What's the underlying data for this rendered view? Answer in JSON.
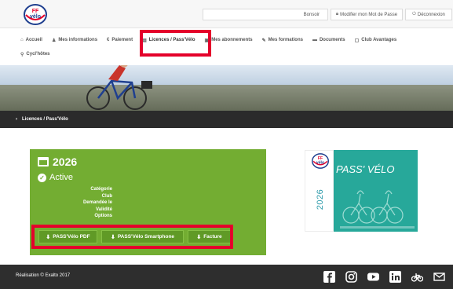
{
  "header": {
    "greeting": "Bonsoir",
    "change_password": "Modifier mon Mot de Passe",
    "logout": "Déconnexion",
    "logo_text_top": "FF",
    "logo_text_bottom": "vélo"
  },
  "nav": {
    "row1": [
      {
        "icon": "home-icon",
        "label": "Accueil",
        "glyph": "⌂"
      },
      {
        "icon": "users-icon",
        "label": "Mes informations",
        "glyph": "♟"
      },
      {
        "icon": "euro-icon",
        "label": "Paiement",
        "glyph": "€"
      },
      {
        "icon": "id-card-icon",
        "label": "Licences / Pass'Vélo",
        "glyph": "▤",
        "active": true
      },
      {
        "icon": "card-icon",
        "label": "Mes abonnements",
        "glyph": "▣"
      },
      {
        "icon": "graduation-cap-icon",
        "label": "Mes formations",
        "glyph": "✎"
      },
      {
        "icon": "folder-icon",
        "label": "Documents",
        "glyph": "▬"
      },
      {
        "icon": "bookmark-icon",
        "label": "Club Avantages",
        "glyph": "▢"
      }
    ],
    "row2": [
      {
        "icon": "search-icon",
        "label": "Cycl'hôtes",
        "glyph": "⚲"
      }
    ]
  },
  "breadcrumb": {
    "label": "Licences / Pass'Vélo"
  },
  "license": {
    "year": "2026",
    "status": "Active",
    "fields": [
      "Catégorie",
      "Club",
      "Demandée le",
      "Validité",
      "Options"
    ],
    "buttons": {
      "pdf": "PASS'Vélo PDF",
      "smartphone": "PASS'Vélo Smartphone",
      "invoice": "Facture"
    }
  },
  "pass_card": {
    "title": "PASS' VÉLO",
    "year": "2026"
  },
  "footer": {
    "credit": "Réalisation © Exalto 2017",
    "social": [
      "facebook-icon",
      "instagram-icon",
      "youtube-icon",
      "linkedin-icon",
      "bike-icon",
      "mail-icon"
    ]
  },
  "colors": {
    "card_green": "#73ad32",
    "highlight_red": "#e4002b",
    "footer_dark": "#2e2e2e",
    "pass_teal": "#27a89a"
  }
}
